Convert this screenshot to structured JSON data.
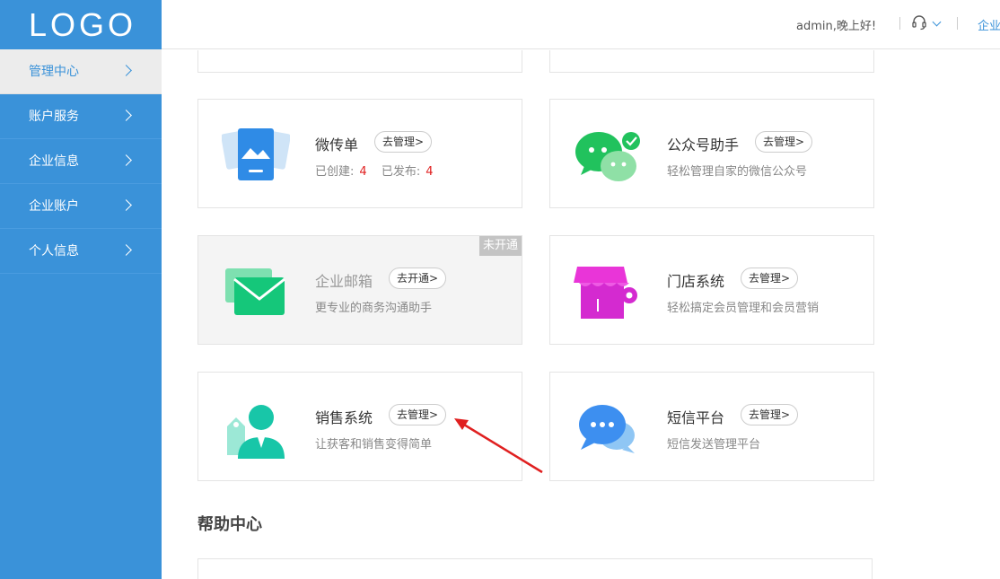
{
  "logo": "LOGO",
  "sidebar": {
    "items": [
      {
        "label": "管理中心"
      },
      {
        "label": "账户服务"
      },
      {
        "label": "企业信息"
      },
      {
        "label": "企业账户"
      },
      {
        "label": "个人信息"
      }
    ]
  },
  "topbar": {
    "greeting": "admin,晚上好!",
    "enterprise_link": "企业"
  },
  "cards": {
    "weichuandan": {
      "title": "微传单",
      "button": "去管理>",
      "created_label": "已创建:",
      "created_count": "4",
      "published_label": "已发布:",
      "published_count": "4"
    },
    "gongzhonghao": {
      "title": "公众号助手",
      "button": "去管理>",
      "desc": "轻松管理自家的微信公众号"
    },
    "mail": {
      "title": "企业邮箱",
      "button": "去开通>",
      "desc": "更专业的商务沟通助手",
      "ribbon": "未开通"
    },
    "store": {
      "title": "门店系统",
      "button": "去管理>",
      "desc": "轻松搞定会员管理和会员营销"
    },
    "sales": {
      "title": "销售系统",
      "button": "去管理>",
      "desc": "让获客和销售变得简单"
    },
    "sms": {
      "title": "短信平台",
      "button": "去管理>",
      "desc": "短信发送管理平台"
    }
  },
  "help": {
    "title": "帮助中心"
  },
  "colors": {
    "sidebar": "#3a92d9",
    "accent": "#3a92d9",
    "count_red": "#e02020",
    "arrow": "#e02020"
  }
}
